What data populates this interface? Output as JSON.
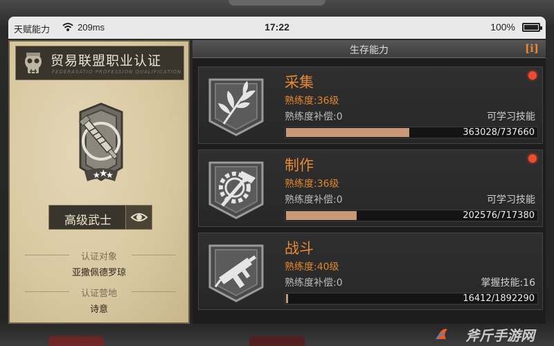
{
  "status_bar": {
    "carrier": "天赋能力",
    "ping": "209ms",
    "time": "17:22",
    "battery": "100%"
  },
  "profile_card": {
    "title": "贸易联盟职业认证",
    "subtitle": "FEDERASATIO PROFESSION QUALIFICATION",
    "rank_label": "高级武士",
    "stars": 3,
    "subject_label": "认证对象",
    "subject_value": "亚撒佩德罗琼",
    "camp_label": "认证营地",
    "camp_value": "诗意"
  },
  "panel": {
    "title": "生存能力",
    "info_button": "i"
  },
  "skills": [
    {
      "name": "采集",
      "proficiency": "熟练度:36级",
      "compensation": "熟练度补偿:0",
      "tag": "可学习技能",
      "progress_text": "363028/737660",
      "progress_fraction": 0.492,
      "has_alert": true,
      "icon": "herb-icon"
    },
    {
      "name": "制作",
      "proficiency": "熟练度:36级",
      "compensation": "熟练度补偿:0",
      "tag": "可学习技能",
      "progress_text": "202576/717380",
      "progress_fraction": 0.282,
      "has_alert": true,
      "icon": "gear-hammer-icon"
    },
    {
      "name": "战斗",
      "proficiency": "熟练度:40级",
      "compensation": "熟练度补偿:0",
      "tag": "掌握技能:16",
      "progress_text": "16412/1892290",
      "progress_fraction": 0.0087,
      "has_alert": false,
      "icon": "submachine-gun-icon"
    }
  ],
  "watermark": "斧斤手游网",
  "colors": {
    "accent": "#e88934",
    "alert": "#f04a2f",
    "bar_fill": "#c99878"
  }
}
